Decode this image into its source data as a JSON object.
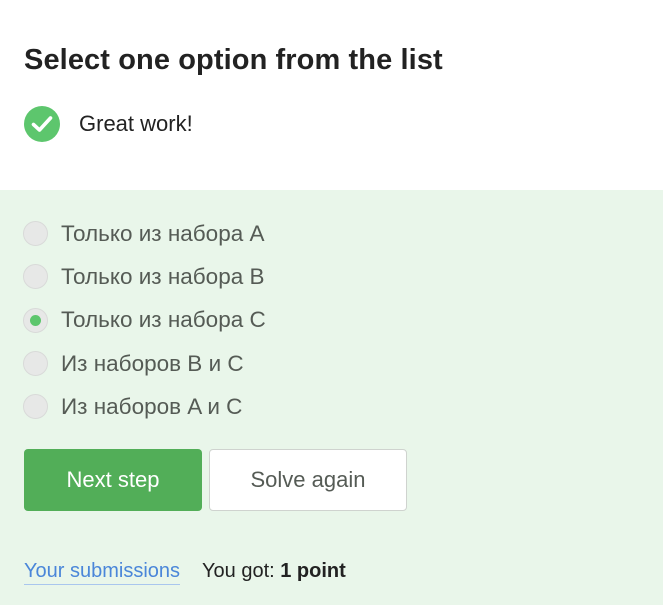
{
  "header": {
    "title": "Select one option from the list",
    "feedback": "Great work!",
    "feedback_icon": "check-circle-icon",
    "accent_color": "#5dc66d"
  },
  "quiz": {
    "background": "#e9f6ea",
    "options": [
      {
        "label": "Только из набора A",
        "selected": false
      },
      {
        "label": "Только из набора B",
        "selected": false
      },
      {
        "label": "Только из набора C",
        "selected": true
      },
      {
        "label": "Из наборов B и C",
        "selected": false
      },
      {
        "label": "Из наборов A и C",
        "selected": false
      }
    ]
  },
  "actions": {
    "next_label": "Next step",
    "solve_again_label": "Solve again",
    "next_color": "#52ae58"
  },
  "footer": {
    "submissions_link": "Your submissions",
    "score_prefix": "You got: ",
    "score_value": "1 point"
  }
}
